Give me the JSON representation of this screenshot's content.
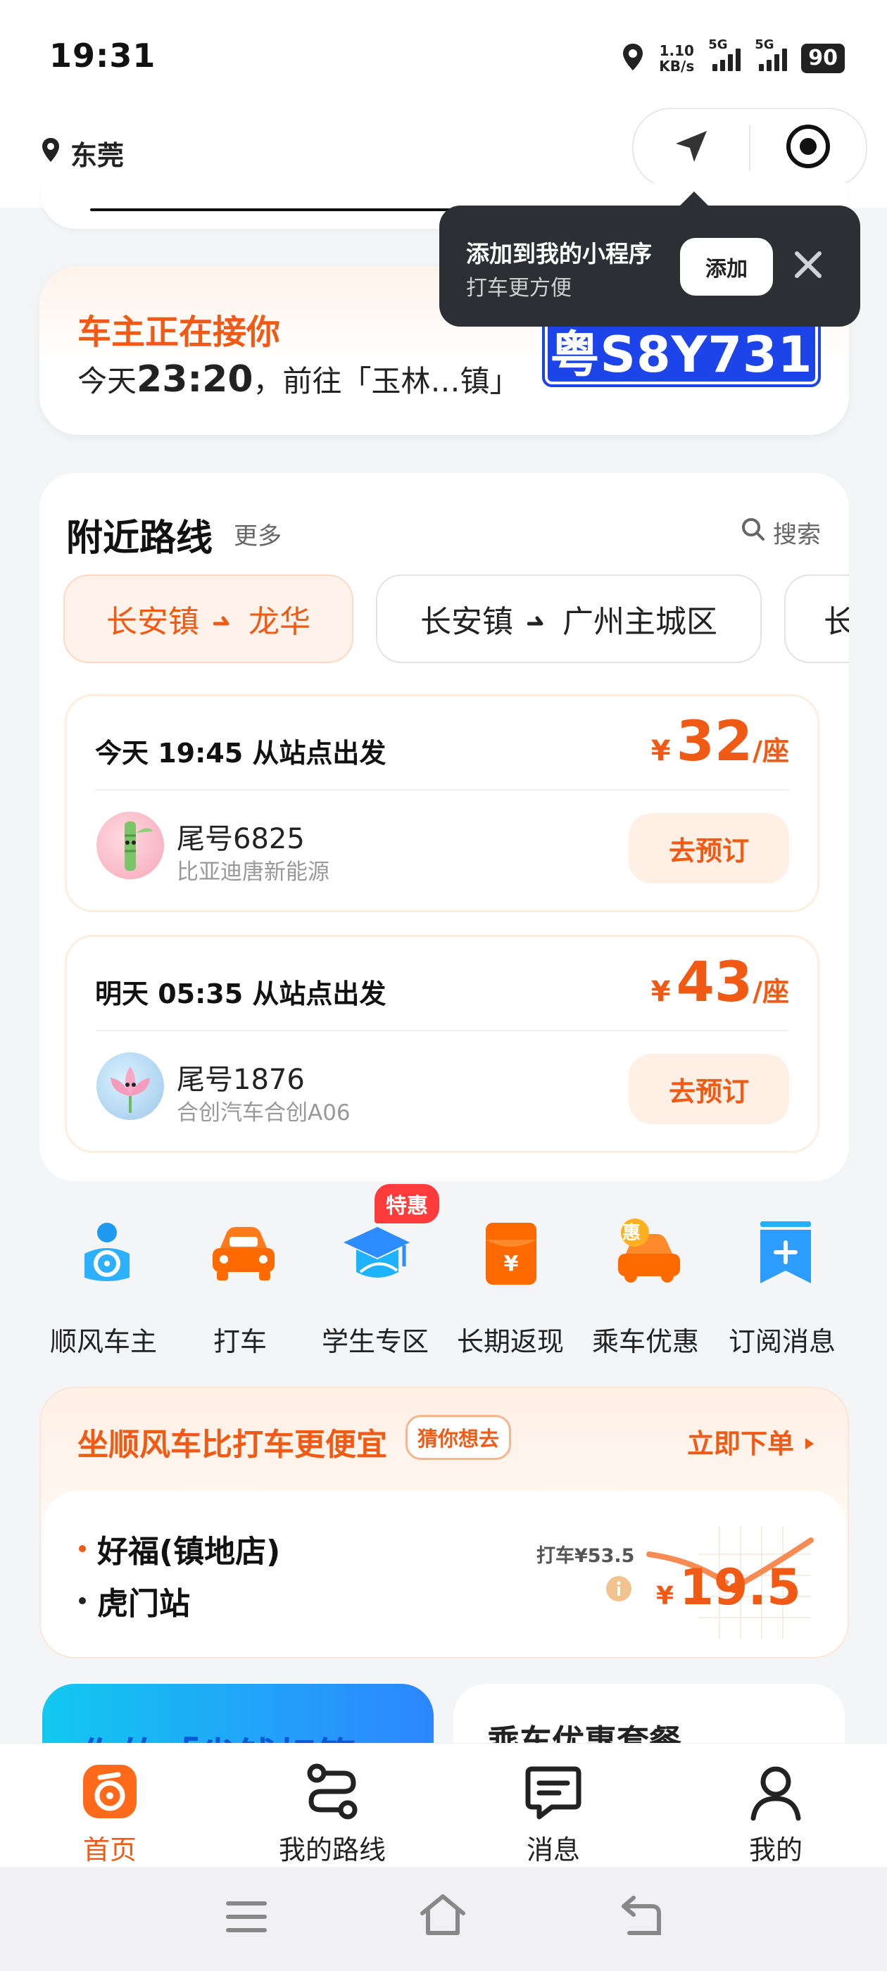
{
  "status_bar": {
    "time": "19:31",
    "net_speed_value": "1.10",
    "net_speed_unit": "KB/s",
    "signal_1": "5G",
    "signal_2": "5G",
    "battery": "90"
  },
  "header": {
    "location": "东莞"
  },
  "tooltip": {
    "title": "添加到我的小程序",
    "subtitle": "打车更方便",
    "add_button": "添加"
  },
  "driver_card": {
    "title": "车主正在接你",
    "trip_prefix": "今天",
    "trip_time": "23:20",
    "trip_suffix": "，前往「玉林…镇」",
    "plate": "粤S8Y731"
  },
  "nearby_routes": {
    "title": "附近路线",
    "more": "更多",
    "search": "搜索",
    "route_chips": [
      {
        "from": "长安镇",
        "to": "龙华",
        "active": true
      },
      {
        "from": "长安镇",
        "to": "广州主城区",
        "active": false
      },
      {
        "from": "长",
        "to": "",
        "active": false
      }
    ],
    "trips": [
      {
        "time": "今天 19:45 从站点出发",
        "currency": "¥",
        "price": "32",
        "unit": "/座",
        "tail": "尾号6825",
        "car": "比亚迪唐新能源",
        "book": "去预订"
      },
      {
        "time": "明天 05:35 从站点出发",
        "currency": "¥",
        "price": "43",
        "unit": "/座",
        "tail": "尾号1876",
        "car": "合创汽车合创A06",
        "book": "去预订"
      }
    ]
  },
  "quick_actions": [
    {
      "label": "顺风车主",
      "icon": "steering-wheel-icon"
    },
    {
      "label": "打车",
      "icon": "taxi-icon"
    },
    {
      "label": "学生专区",
      "icon": "graduation-cap-icon",
      "badge": "特惠"
    },
    {
      "label": "长期返现",
      "icon": "red-envelope-icon"
    },
    {
      "label": "乘车优惠",
      "icon": "discount-car-icon",
      "mark": "惠"
    },
    {
      "label": "订阅消息",
      "icon": "subscribe-icon"
    }
  ],
  "promo": {
    "title": "坐顺风车比打车更便宜",
    "tag": "猜你想去",
    "cta": "立即下单",
    "from": "好福(镇地店)",
    "to": "虎门站",
    "taxi_price": "打车¥53.5",
    "currency": "¥",
    "price": "19.5"
  },
  "bottom_cards": {
    "left_text": "你的「省钱标签",
    "right_text": "乘车优惠套餐"
  },
  "tabbar": [
    {
      "label": "首页",
      "icon": "home-icon",
      "active": true
    },
    {
      "label": "我的路线",
      "icon": "route-icon",
      "active": false
    },
    {
      "label": "消息",
      "icon": "message-icon",
      "active": false
    },
    {
      "label": "我的",
      "icon": "profile-icon",
      "active": false
    }
  ],
  "colors": {
    "accent": "#f05a14",
    "plate_blue": "#1d44e8",
    "tooltip_bg": "#2c2f33"
  }
}
